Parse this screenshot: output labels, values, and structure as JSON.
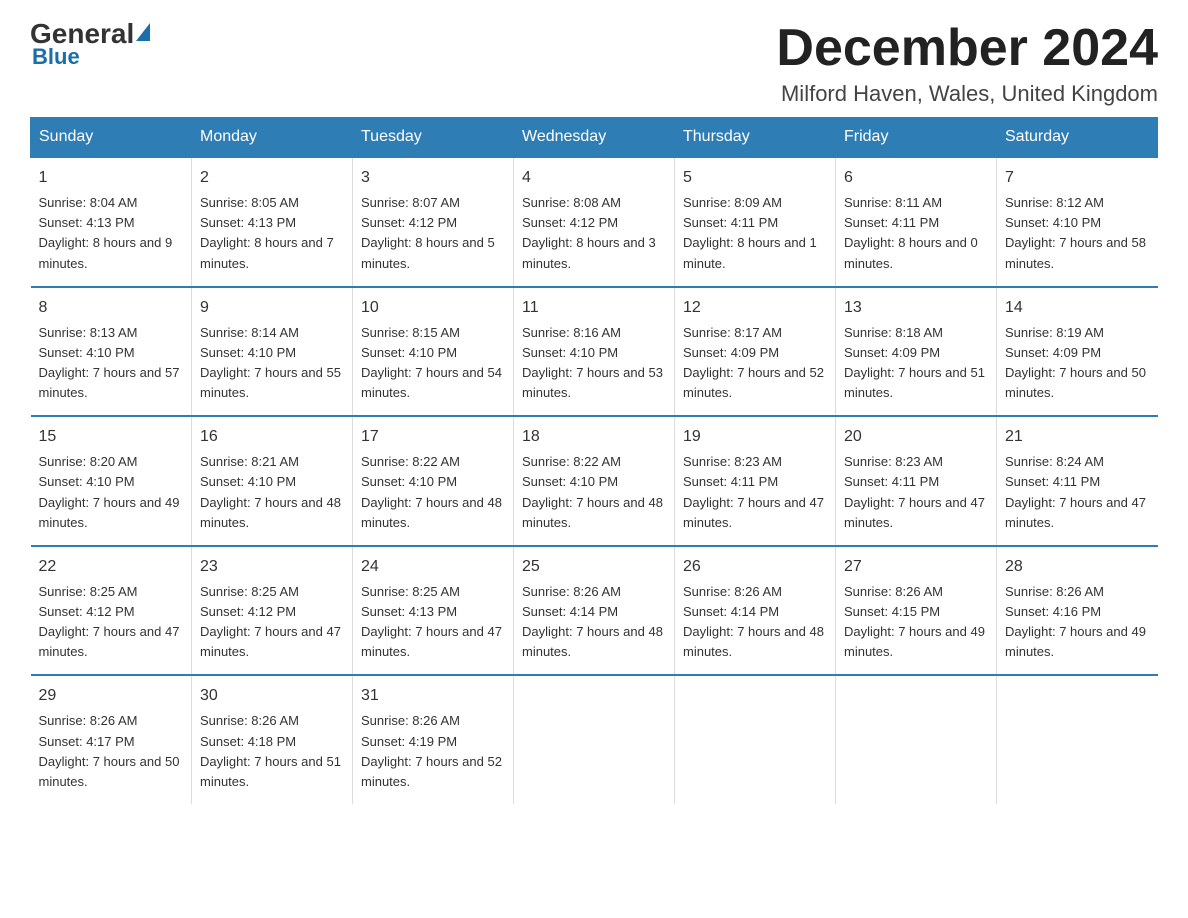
{
  "logo": {
    "general": "General",
    "blue": "Blue"
  },
  "header": {
    "month": "December 2024",
    "location": "Milford Haven, Wales, United Kingdom"
  },
  "weekdays": [
    "Sunday",
    "Monday",
    "Tuesday",
    "Wednesday",
    "Thursday",
    "Friday",
    "Saturday"
  ],
  "weeks": [
    [
      {
        "day": "1",
        "sunrise": "8:04 AM",
        "sunset": "4:13 PM",
        "daylight": "8 hours and 9 minutes."
      },
      {
        "day": "2",
        "sunrise": "8:05 AM",
        "sunset": "4:13 PM",
        "daylight": "8 hours and 7 minutes."
      },
      {
        "day": "3",
        "sunrise": "8:07 AM",
        "sunset": "4:12 PM",
        "daylight": "8 hours and 5 minutes."
      },
      {
        "day": "4",
        "sunrise": "8:08 AM",
        "sunset": "4:12 PM",
        "daylight": "8 hours and 3 minutes."
      },
      {
        "day": "5",
        "sunrise": "8:09 AM",
        "sunset": "4:11 PM",
        "daylight": "8 hours and 1 minute."
      },
      {
        "day": "6",
        "sunrise": "8:11 AM",
        "sunset": "4:11 PM",
        "daylight": "8 hours and 0 minutes."
      },
      {
        "day": "7",
        "sunrise": "8:12 AM",
        "sunset": "4:10 PM",
        "daylight": "7 hours and 58 minutes."
      }
    ],
    [
      {
        "day": "8",
        "sunrise": "8:13 AM",
        "sunset": "4:10 PM",
        "daylight": "7 hours and 57 minutes."
      },
      {
        "day": "9",
        "sunrise": "8:14 AM",
        "sunset": "4:10 PM",
        "daylight": "7 hours and 55 minutes."
      },
      {
        "day": "10",
        "sunrise": "8:15 AM",
        "sunset": "4:10 PM",
        "daylight": "7 hours and 54 minutes."
      },
      {
        "day": "11",
        "sunrise": "8:16 AM",
        "sunset": "4:10 PM",
        "daylight": "7 hours and 53 minutes."
      },
      {
        "day": "12",
        "sunrise": "8:17 AM",
        "sunset": "4:09 PM",
        "daylight": "7 hours and 52 minutes."
      },
      {
        "day": "13",
        "sunrise": "8:18 AM",
        "sunset": "4:09 PM",
        "daylight": "7 hours and 51 minutes."
      },
      {
        "day": "14",
        "sunrise": "8:19 AM",
        "sunset": "4:09 PM",
        "daylight": "7 hours and 50 minutes."
      }
    ],
    [
      {
        "day": "15",
        "sunrise": "8:20 AM",
        "sunset": "4:10 PM",
        "daylight": "7 hours and 49 minutes."
      },
      {
        "day": "16",
        "sunrise": "8:21 AM",
        "sunset": "4:10 PM",
        "daylight": "7 hours and 48 minutes."
      },
      {
        "day": "17",
        "sunrise": "8:22 AM",
        "sunset": "4:10 PM",
        "daylight": "7 hours and 48 minutes."
      },
      {
        "day": "18",
        "sunrise": "8:22 AM",
        "sunset": "4:10 PM",
        "daylight": "7 hours and 48 minutes."
      },
      {
        "day": "19",
        "sunrise": "8:23 AM",
        "sunset": "4:11 PM",
        "daylight": "7 hours and 47 minutes."
      },
      {
        "day": "20",
        "sunrise": "8:23 AM",
        "sunset": "4:11 PM",
        "daylight": "7 hours and 47 minutes."
      },
      {
        "day": "21",
        "sunrise": "8:24 AM",
        "sunset": "4:11 PM",
        "daylight": "7 hours and 47 minutes."
      }
    ],
    [
      {
        "day": "22",
        "sunrise": "8:25 AM",
        "sunset": "4:12 PM",
        "daylight": "7 hours and 47 minutes."
      },
      {
        "day": "23",
        "sunrise": "8:25 AM",
        "sunset": "4:12 PM",
        "daylight": "7 hours and 47 minutes."
      },
      {
        "day": "24",
        "sunrise": "8:25 AM",
        "sunset": "4:13 PM",
        "daylight": "7 hours and 47 minutes."
      },
      {
        "day": "25",
        "sunrise": "8:26 AM",
        "sunset": "4:14 PM",
        "daylight": "7 hours and 48 minutes."
      },
      {
        "day": "26",
        "sunrise": "8:26 AM",
        "sunset": "4:14 PM",
        "daylight": "7 hours and 48 minutes."
      },
      {
        "day": "27",
        "sunrise": "8:26 AM",
        "sunset": "4:15 PM",
        "daylight": "7 hours and 49 minutes."
      },
      {
        "day": "28",
        "sunrise": "8:26 AM",
        "sunset": "4:16 PM",
        "daylight": "7 hours and 49 minutes."
      }
    ],
    [
      {
        "day": "29",
        "sunrise": "8:26 AM",
        "sunset": "4:17 PM",
        "daylight": "7 hours and 50 minutes."
      },
      {
        "day": "30",
        "sunrise": "8:26 AM",
        "sunset": "4:18 PM",
        "daylight": "7 hours and 51 minutes."
      },
      {
        "day": "31",
        "sunrise": "8:26 AM",
        "sunset": "4:19 PM",
        "daylight": "7 hours and 52 minutes."
      },
      null,
      null,
      null,
      null
    ]
  ]
}
